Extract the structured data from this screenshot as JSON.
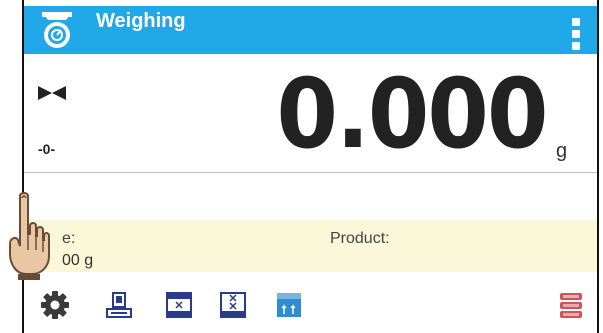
{
  "header": {
    "title": "Weighing",
    "app_icon": "scale-icon",
    "menu_icon": "vertical-dots-icon",
    "color": "#21a8e8"
  },
  "weight": {
    "value": "0.000",
    "unit": "g",
    "stability_icon": "stable-bowtie-icon",
    "zero_indicator": "-0-"
  },
  "info": {
    "tare_label": "e:",
    "tare_value": "00 g",
    "product_label": "Product:",
    "background": "#fbf7d9"
  },
  "toolbar": {
    "buttons": [
      {
        "icon": "gear-icon"
      },
      {
        "icon": "tare-scale-icon"
      },
      {
        "icon": "stack-form-icon"
      },
      {
        "icon": "stack-form-2-icon"
      },
      {
        "icon": "sort-blocks-icon"
      },
      {
        "icon": "database-icon"
      }
    ]
  },
  "overlay": {
    "icon": "pointing-hand-icon"
  }
}
